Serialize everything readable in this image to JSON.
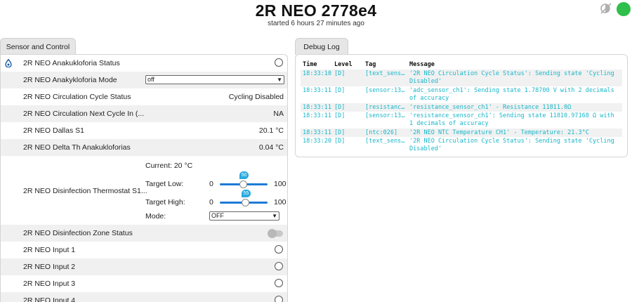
{
  "header": {
    "title": "2R NEO 2778e4",
    "subtitle": "started 6 hours 27 minutes ago",
    "status_color": "#2fbf4a",
    "scheme_icon": "color-scheme-icon"
  },
  "tabs": {
    "sensor_label": "Sensor and Control",
    "debug_label": "Debug Log"
  },
  "entities": [
    {
      "name": "2R NEO Anakukloforia Status",
      "state": "",
      "icon": "water-drop-icon",
      "control": "radio"
    },
    {
      "name": "2R NEO Anakykloforia Mode",
      "state": "off",
      "control": "select"
    },
    {
      "name": "2R NEO Circulation Cycle Status",
      "state": "Cycling Disabled"
    },
    {
      "name": "2R NEO Circulation Next Cycle In (...",
      "state": "NA"
    },
    {
      "name": "2R NEO Dallas S1",
      "state": "20.1 °C"
    },
    {
      "name": "2R NEO Delta Th Anakukloforias",
      "state": "0.04 °C"
    }
  ],
  "thermostat": {
    "name": "2R NEO Disinfection Thermostat S1...",
    "current": "Current: 20 °C",
    "low_label": "Target Low:",
    "low_min": "0",
    "low_max": "100",
    "low_value": "50",
    "high_label": "Target High:",
    "high_min": "0",
    "high_max": "100",
    "high_value": "55",
    "mode_label": "Mode:",
    "mode_value": "OFF"
  },
  "entities2": [
    {
      "name": "2R NEO Disinfection Zone Status",
      "control": "toggle"
    },
    {
      "name": "2R NEO Input 1",
      "control": "radio"
    },
    {
      "name": "2R NEO Input 2",
      "control": "radio"
    },
    {
      "name": "2R NEO Input 3",
      "control": "radio"
    },
    {
      "name": "2R NEO Input 4",
      "control": "radio"
    }
  ],
  "debug": {
    "headers": {
      "time": "Time",
      "level": "Level",
      "tag": "Tag",
      "message": "Message"
    },
    "log_color": "#18b6c9",
    "rows": [
      {
        "time": "18:33:10",
        "level": "[D]",
        "tag": "[text_sensor…",
        "message": "'2R NEO Circulation Cycle Status': Sending state 'Cycling Disabled'"
      },
      {
        "time": "18:33:11",
        "level": "[D]",
        "tag": "[sensor:131]",
        "message": "'adc_sensor_ch1': Sending state 1.78700 V with 2 decimals of accuracy"
      },
      {
        "time": "18:33:11",
        "level": "[D]",
        "tag": "[resistance:…",
        "message": "'resistance_sensor_ch1' - Resistance 11811.0Ω"
      },
      {
        "time": "18:33:11",
        "level": "[D]",
        "tag": "[sensor:131]",
        "message": "'resistance_sensor_ch1': Sending state 11810.97168 Ω with 1 decimals of accuracy"
      },
      {
        "time": "18:33:11",
        "level": "[D]",
        "tag": "[ntc:026]",
        "message": "'2R NEO NTC Temperature CH1' - Temperature: 21.3°C"
      },
      {
        "time": "18:33:20",
        "level": "[D]",
        "tag": "[text_sensor…",
        "message": "'2R NEO Circulation Cycle Status': Sending state 'Cycling Disabled'"
      }
    ]
  }
}
